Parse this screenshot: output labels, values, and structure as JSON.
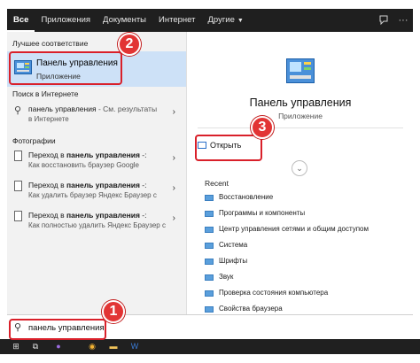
{
  "tabs": [
    {
      "label": "Все",
      "active": true
    },
    {
      "label": "Приложения"
    },
    {
      "label": "Документы"
    },
    {
      "label": "Интернет"
    },
    {
      "label": "Другие",
      "has_dropdown": true
    }
  ],
  "top_icons": [
    "feedback-icon",
    "more-icon"
  ],
  "left": {
    "best_match_header": "Лучшее соответствие",
    "best_match": {
      "title": "Панель управления",
      "subtitle": "Приложение",
      "icon": "control-panel-icon"
    },
    "web_header": "Поиск в Интернете",
    "web_item": {
      "line1_query": "панель управления",
      "line1_suffix": " - См. результаты",
      "line2": "в Интернете"
    },
    "photos_header": "Фотографии",
    "photos": [
      {
        "prefix": "Переход в ",
        "bold": "панель управления",
        "suffix": " -:",
        "line2": "Как восстановить браузер Google"
      },
      {
        "prefix": "Переход в ",
        "bold": "панель управления",
        "suffix": " -:",
        "line2": "Как удалить браузер Яндекс Браузер с"
      },
      {
        "prefix": "Переход в ",
        "bold": "панель управления",
        "suffix": " -:",
        "line2": "Как полностью удалить Яндекс Браузер с"
      }
    ]
  },
  "right": {
    "title": "Панель управления",
    "subtitle": "Приложение",
    "open_label": "Открыть",
    "recent_header": "Recent",
    "recent": [
      "Восстановление",
      "Программы и компоненты",
      "Центр управления сетями и общим доступом",
      "Система",
      "Шрифты",
      "Звук",
      "Проверка состояния компьютера",
      "Свойства браузера"
    ]
  },
  "search": {
    "value": "панель управления"
  },
  "badges": {
    "one": "1",
    "two": "2",
    "three": "3"
  },
  "colors": {
    "topbar": "#1f1f1f",
    "selected": "#cde1f7",
    "highlight": "#d9202a",
    "taskbar": "#202020"
  }
}
